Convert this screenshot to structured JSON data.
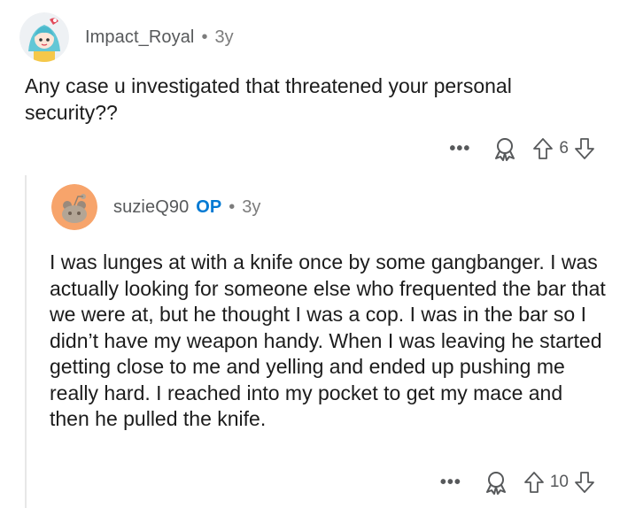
{
  "top_comment": {
    "username": "Impact_Royal",
    "separator": "•",
    "age": "3y",
    "body": "Any case u investigated that threatened your personal security??",
    "more_label": "•••",
    "score": "6"
  },
  "reply": {
    "username": "suzieQ90",
    "op_badge": "OP",
    "separator": "•",
    "age": "3y",
    "body": "I was lunges at with a knife once by some gangbanger. I was actually looking for someone else who frequented the bar that we were at, but he thought I was a cop. I was in the bar so I didn’t have my weapon handy. When I was leaving he started getting close to me and yelling and ended up pushing me really hard. I reached into my pocket to get my mace and then he pulled the knife.",
    "more_label": "•••",
    "score": "10"
  },
  "colors": {
    "text": "#1c1c1c",
    "meta": "#7c7c7c",
    "op": "#0079d3",
    "thread_line": "#e7e7e7"
  },
  "icons": [
    "avatar-anime",
    "avatar-snoo",
    "more-icon",
    "award-icon",
    "upvote-icon",
    "downvote-icon"
  ]
}
